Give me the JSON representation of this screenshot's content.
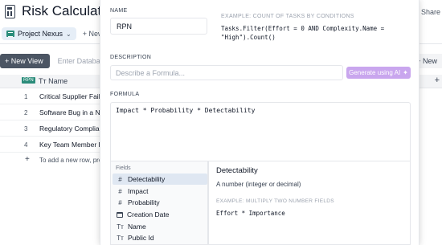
{
  "app": {
    "title": "Risk Calculator",
    "share_label": "Share"
  },
  "tabs": {
    "active": "Project Nexus",
    "new_label": "+ New Dat"
  },
  "toolbar": {
    "new_view": "+ New View",
    "db_description": "Enter Database desc",
    "new_right": "+ New"
  },
  "grid": {
    "rpn_badge": "RPN",
    "name_header": "Name",
    "rows": [
      {
        "num": "1",
        "text": "Critical Supplier Fails to"
      },
      {
        "num": "2",
        "text": "Software Bug in a New I"
      },
      {
        "num": "3",
        "text": "Regulatory Compliance"
      },
      {
        "num": "4",
        "text": "Key Team Member Leav"
      }
    ],
    "add_row_text": "To add a new row, press"
  },
  "modal": {
    "name_label": "NAME",
    "name_value": "RPN",
    "example_label": "EXAMPLE: COUNT OF TASKS BY CONDITIONS",
    "example_code": "Tasks.Filter(Effort = 0 AND Complexity.Name = \"High\").Count()",
    "description_label": "DESCRIPTION",
    "description_placeholder": "Describe a Formula...",
    "generate_ai_label": "Generate using AI",
    "formula_label": "FORMULA",
    "formula_value": "Impact * Probability * Detectability",
    "fields_header": "Fields",
    "fields": [
      {
        "name": "Detectability",
        "icon": "hash-icon",
        "selected": true
      },
      {
        "name": "Impact",
        "icon": "hash-icon"
      },
      {
        "name": "Probability",
        "icon": "hash-icon"
      },
      {
        "name": "Creation Date",
        "icon": "calendar-icon"
      },
      {
        "name": "Name",
        "icon": "text-type-icon"
      },
      {
        "name": "Public Id",
        "icon": "text-type-icon"
      }
    ],
    "detail": {
      "title": "Detectability",
      "description": "A number (integer or decimal)",
      "example_label": "EXAMPLE: MULTIPLY TWO NUMBER FIELDS",
      "example_code": "Effort * Importance"
    }
  },
  "colors": {
    "accent_teal": "#2a8c7a",
    "ai_button": "#c9a6ee",
    "selected_field": "#dfe7f2"
  }
}
